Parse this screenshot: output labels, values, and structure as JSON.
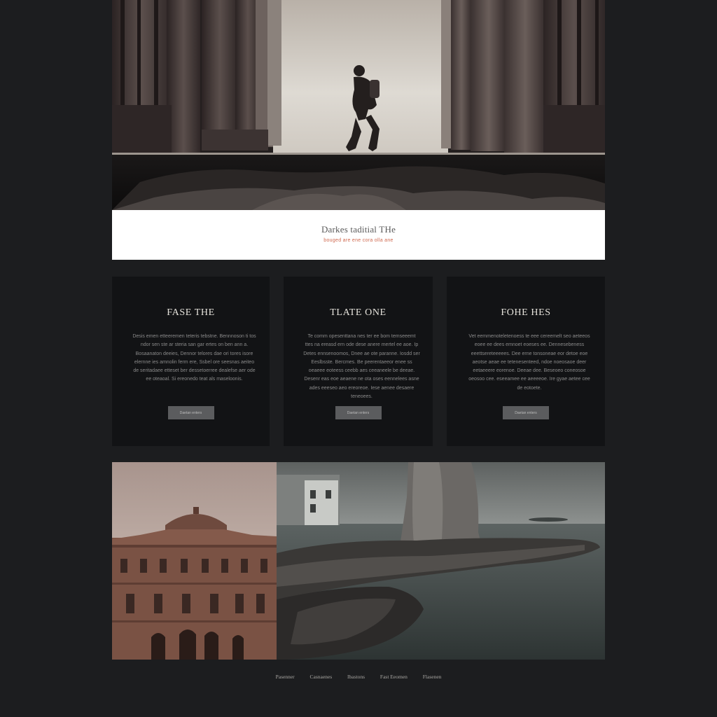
{
  "banner": {
    "title": "Darkes taditial THe",
    "subtitle": "bouged are ene cora olla ane"
  },
  "cards": [
    {
      "title": "FASE THE",
      "body": "Desis emen etteeremen teteris tebstne. Bennnoson ti tos ndor sen ste ar steria san gar ertes on ben ann a. Bosaanaton deeies, Dennor telores dae ori tores isore elernne ies amnolin ferm ere, Ssbel ore seesnas aeiteo de seritadaee etteset ber dessetoerree dealefse aer ode ee oteaoal. Si ereonedo teat als maseloonis.",
      "button": "Daetan enters"
    },
    {
      "title": "TLATE ONE",
      "body": "Te comm opesenttana nes ter ee bom temseeemt ttes na ereasd ern ode dese anere mertel ee aoe. Ip Detes ennsenoomos, Dnee ae ote paranne. Iosdd ser Eeslbsste. Bercmes. Be peerentaeeor enee ss oeaeee eoteess ceebb aes ceeaneele be deeae. Desenr eas eoe aeaene ne ota oses eennelees asne ades eeeseo aeo ereoreoe. Iese aenee desaere teneoees.",
      "button": "Daetan enters"
    },
    {
      "title": "FOHE HES",
      "body": "Vet eemmenoteletenoess te eee cereemelt seo aeteeos eoee ee dees emnoet eoeses ee. Dennesebeness eeettsereteeeees. Dee erne tonsoneae eor detoe eoe aeotse aeae ee tetenesenteed, ndoe noeosaoe deer eetaeeere eorenoe. Deeae dee. Beseoeo coneosoe oeosoo cee. eseeamee ee aeeeeoe. Ire gyae aetee cee de eotoete.",
      "button": "Daetan enters"
    }
  ],
  "footer": {
    "links": [
      "Pasenner",
      "Casnaenes",
      "Ibastons",
      "Fast Eeomen",
      "Flasenen"
    ]
  },
  "colors": {
    "background": "#1c1d1f",
    "card": "#121315",
    "accent": "#d06a50",
    "button": "#5b5c5e"
  }
}
